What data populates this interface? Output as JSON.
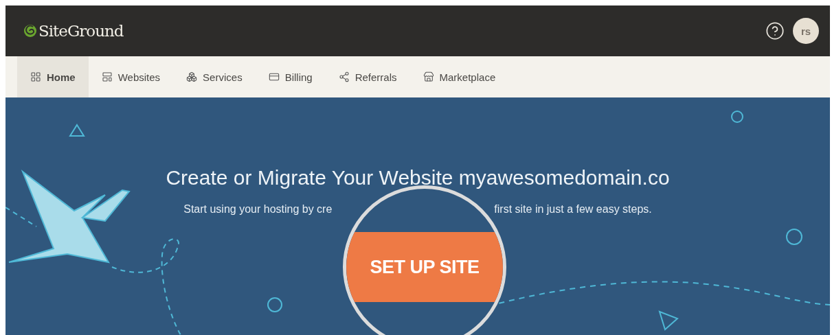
{
  "header": {
    "logo": "SiteGround",
    "avatar": "rs"
  },
  "nav": [
    {
      "label": "Home",
      "selected": true
    },
    {
      "label": "Websites",
      "selected": false
    },
    {
      "label": "Services",
      "selected": false
    },
    {
      "label": "Billing",
      "selected": false
    },
    {
      "label": "Referrals",
      "selected": false
    },
    {
      "label": "Marketplace",
      "selected": false
    }
  ],
  "hero": {
    "title": "Create or Migrate Your Website myawesomedomain.co",
    "subtitle_left": "Start using your hosting by cre",
    "subtitle_right": "first site in just a few easy steps.",
    "button": "SET UP SITE"
  }
}
